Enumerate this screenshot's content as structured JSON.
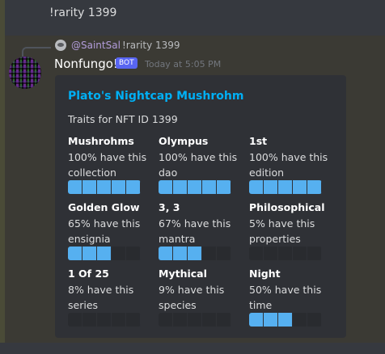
{
  "top_message": {
    "text": "!rarity 1399"
  },
  "reply": {
    "user": "@SaintSal",
    "text": "!rarity 1399"
  },
  "message": {
    "username": "Nonfungo!",
    "bot_tag": "BOT",
    "timestamp": "Today at 5:05 PM"
  },
  "embed": {
    "title": "Plato's Nightcap Mushrohm",
    "description": "Traits for NFT ID 1399",
    "fields": [
      {
        "name": "Mushrohms",
        "value": "100% have this collection",
        "percent": 100
      },
      {
        "name": "Olympus",
        "value": "100% have this dao",
        "percent": 100
      },
      {
        "name": "1st",
        "value": "100% have this edition",
        "percent": 100
      },
      {
        "name": "Golden Glow",
        "value": "65% have this ensignia",
        "percent": 65
      },
      {
        "name": "3, 3",
        "value": "67% have this mantra",
        "percent": 67
      },
      {
        "name": "Philosophical",
        "value": "5% have this properties",
        "percent": 5
      },
      {
        "name": "1 Of 25",
        "value": "8% have this series",
        "percent": 8
      },
      {
        "name": "Mythical",
        "value": "9% have this species",
        "percent": 9
      },
      {
        "name": "Night",
        "value": "50% have this time",
        "percent": 50
      }
    ]
  },
  "colors": {
    "accent": "#00aff4",
    "bar_fill": "#56b0f0",
    "bot_tag": "#5865f2",
    "reply_user": "#b39ddb"
  }
}
